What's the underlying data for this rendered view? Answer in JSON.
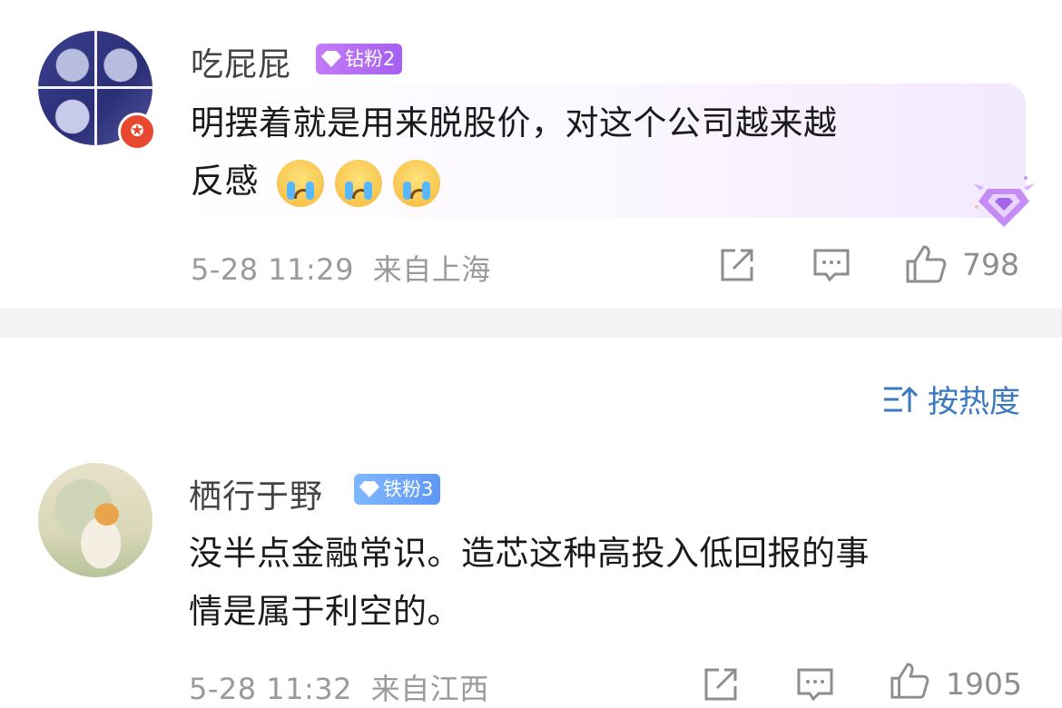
{
  "comments": [
    {
      "username": "吃屁屁",
      "badge": "钻粉2",
      "text_line1": "明摆着就是用来脱股价，对这个公司越来越",
      "text_line2": "反感",
      "emoji_count": 3,
      "time": "5-28 11:29",
      "location": "来自上海",
      "likes": "798"
    },
    {
      "username": "栖行于野",
      "badge": "铁粉3",
      "text_line1": "没半点金融常识。造芯这种高投入低回报的事",
      "text_line2": "情是属于利空的。",
      "time": "5-28 11:32",
      "location": "来自江西",
      "likes": "1905"
    }
  ],
  "sort": {
    "label": "按热度"
  },
  "colors": {
    "accent": "#3a78c0",
    "badge_purple": "#b06cf2",
    "badge_blue": "#6aa6fb",
    "divider": "#f2f2f2"
  }
}
